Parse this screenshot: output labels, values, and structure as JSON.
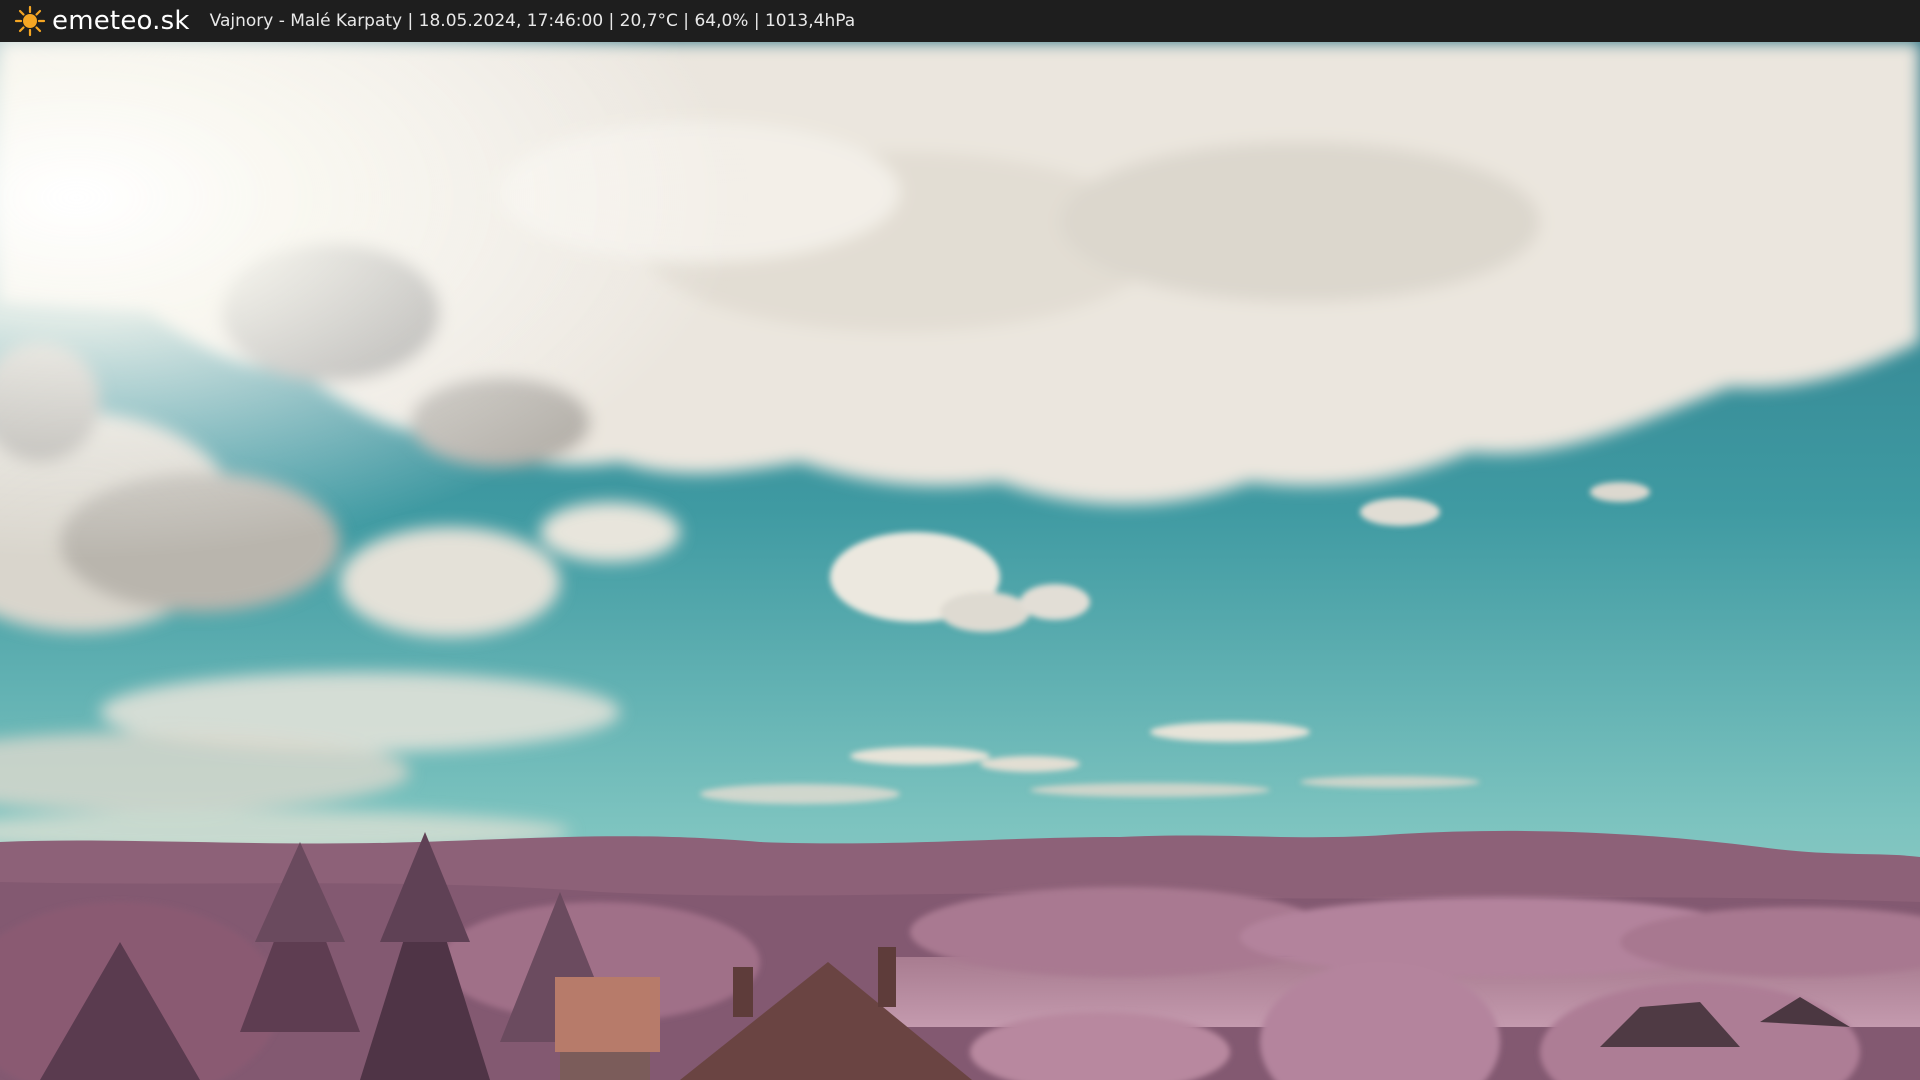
{
  "header": {
    "brand": "emeteo.sk",
    "logo_icon": "sun-icon",
    "status_text": "Vajnory - Malé Karpaty | 18.05.2024, 17:46:00 | 20,7°C | 64,0% | 1013,4hPa"
  },
  "colors": {
    "bar_background": "#1e1e1e",
    "sun_logo": "#f5a623",
    "sky_top": "#2e7f8f",
    "sky_horizon": "#7cc0c0",
    "cloud": "#ece8e2",
    "hills": "#8a5f78",
    "vegetation": "#b3819e"
  }
}
